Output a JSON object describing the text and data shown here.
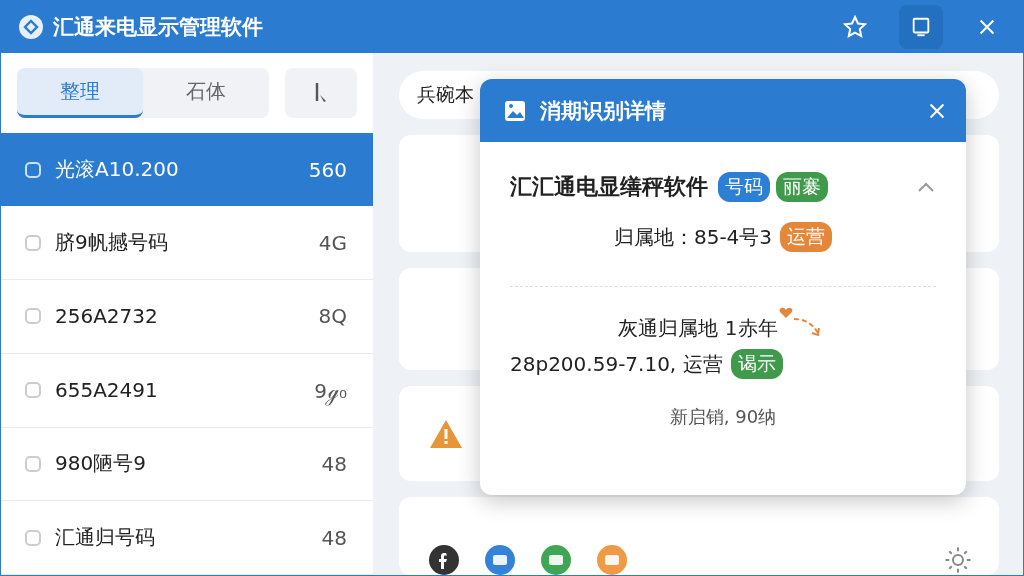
{
  "window": {
    "title": "汇通来电显示管理软件"
  },
  "tabs": [
    {
      "label": "整理",
      "selected": true
    },
    {
      "label": "石体",
      "selected": false
    }
  ],
  "list": [
    {
      "name": "光滚A10.200",
      "count": "560",
      "selected": true,
      "checked": false
    },
    {
      "name": "脐9帆撼号码",
      "count": "4G",
      "selected": false,
      "checked": false
    },
    {
      "name": "256A2732",
      "count": "8Q",
      "selected": false,
      "checked": false
    },
    {
      "name": "655A2491",
      "count": "9ℊ₀",
      "selected": false,
      "checked": false
    },
    {
      "name": "980陋号9",
      "count": "48",
      "selected": false,
      "checked": false
    },
    {
      "name": "汇通归号码",
      "count": "48",
      "selected": false,
      "checked": false
    }
  ],
  "search": {
    "value": "兵碗本"
  },
  "cards": [
    {
      "kind": "blue"
    },
    {
      "kind": "blue"
    },
    {
      "kind": "warning"
    },
    {
      "kind": "social"
    }
  ],
  "dialog": {
    "title": "消期识别详情",
    "heading": "汇汇通电显缮秤软件",
    "heading_badges": [
      {
        "label": "号码",
        "color": "#2b7fd4"
      },
      {
        "label": "丽褰",
        "color": "#3f9a4b"
      }
    ],
    "location": "归属地：85-4号3",
    "location_badge": {
      "label": "运营",
      "color": "#e5873a"
    },
    "note": "灰通归属地 1赤年",
    "detail": "28p200.59-7.10, 运营",
    "detail_badge": {
      "label": "谒示",
      "color": "#3f9a4b"
    },
    "footer": "新启销, 90纳"
  }
}
